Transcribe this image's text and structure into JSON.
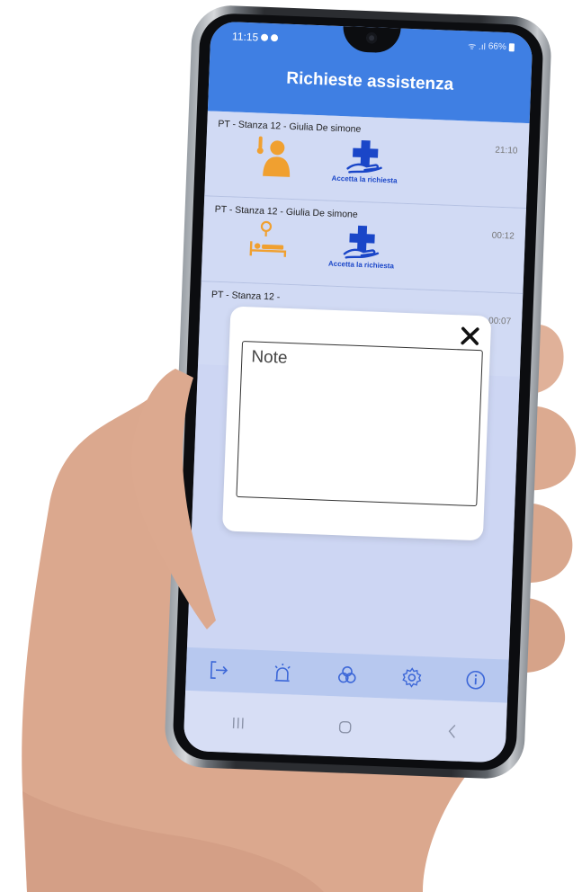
{
  "status_bar": {
    "time": "11:15",
    "signal": "ᯤ .ıl",
    "battery": "66%"
  },
  "header": {
    "title": "Richieste assistenza"
  },
  "requests": [
    {
      "title": "PT - Stanza 12 - Giulia De simone",
      "time": "21:10",
      "icon": "patient-fever-icon",
      "accept_label": "Accetta la richiesta"
    },
    {
      "title": "PT - Stanza 12 - Giulia De simone",
      "time": "00:12",
      "icon": "bed-location-icon",
      "accept_label": "Accetta la richiesta"
    },
    {
      "title": "PT - Stanza 12 -",
      "time": "00:07"
    }
  ],
  "modal": {
    "note_placeholder": "Note",
    "close_label": "✕"
  },
  "bottom_nav": [
    {
      "name": "logout",
      "icon": "logout-icon"
    },
    {
      "name": "alarm",
      "icon": "siren-icon"
    },
    {
      "name": "medicines",
      "icon": "pills-icon"
    },
    {
      "name": "settings",
      "icon": "gear-icon"
    },
    {
      "name": "info",
      "icon": "info-icon"
    }
  ],
  "colors": {
    "header": "#3f7fe3",
    "list_bg": "#d1daf4",
    "accent_orange": "#f0a030",
    "accent_blue": "#1a46c8",
    "nav_bg": "#b7c8ef"
  }
}
